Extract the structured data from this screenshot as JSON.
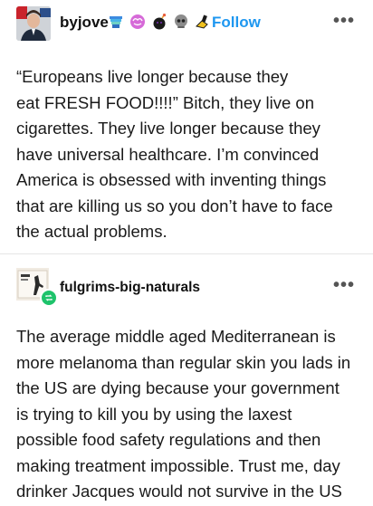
{
  "post1": {
    "username": "byjove",
    "follow_label": "Follow",
    "more_label": "•••",
    "badges": [
      "rainbow-cup-icon",
      "pink-brain-icon",
      "black-bomb-icon",
      "grey-skull-icon",
      "yellow-toy-icon"
    ],
    "lines": [
      "“Europeans live longer because they",
      "eat FRESH FOOD!!!!” Bitch, they live on",
      "cigarettes. They live longer because they",
      "have universal healthcare. I’m convinced",
      "America is obsessed with inventing things",
      "that are killing us so you don’t have to face",
      "the actual problems."
    ]
  },
  "post2": {
    "username": "fulgrims-big-naturals",
    "more_label": "•••",
    "lines": [
      "The average middle aged Mediterranean is",
      "more melanoma than regular skin you lads in",
      "the US are dying because your government",
      "is trying to kill you by using the laxest",
      "possible food safety regulations and then",
      "making treatment impossible. Trust me, day",
      "drinker Jacques would not survive in the US"
    ]
  },
  "colors": {
    "accent": "#1e97f0",
    "reblog_green": "#1ec36b",
    "text": "#1a1a1a",
    "divider": "#e5e5e5"
  }
}
